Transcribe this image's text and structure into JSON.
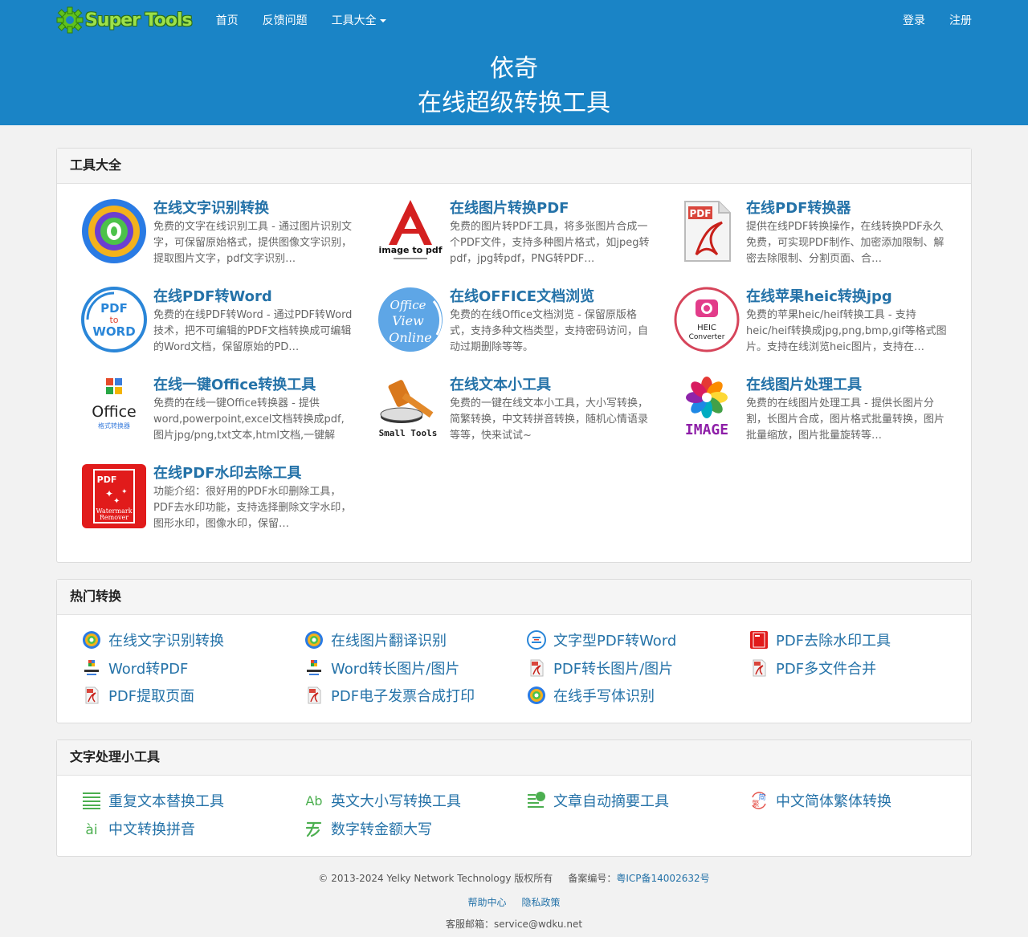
{
  "nav": {
    "logo_text": "Super Tools",
    "links": [
      "首页",
      "反馈问题",
      "工具大全"
    ],
    "login": "登录",
    "register": "注册"
  },
  "hero": {
    "title": "依奇",
    "subtitle": "在线超级转换工具"
  },
  "tools_panel": {
    "title": "工具大全",
    "items": [
      {
        "title": "在线文字识别转换",
        "desc": "免费的文字在线识别工具 - 通过图片识别文字，可保留原始格式，提供图像文字识别，提取图片文字，pdf文字识别…",
        "icon": "ocr-icon"
      },
      {
        "title": "在线图片转换PDF",
        "desc": "免费的图片转PDF工具，将多张图片合成一个PDF文件，支持多种图片格式，如jpeg转pdf，jpg转pdf，PNG转PDF…",
        "icon": "image-to-pdf-icon",
        "icon_label": "image to pdf"
      },
      {
        "title": "在线PDF转换器",
        "desc": "提供在线PDF转换操作，在线转换PDF永久免费，可实现PDF制作、加密添加限制、解密去除限制、分割页面、合…",
        "icon": "pdf-file-icon",
        "icon_label": "PDF"
      },
      {
        "title": "在线PDF转Word",
        "desc": "免费的在线PDF转Word - 通过PDF转Word技术，把不可编辑的PDF文档转换成可编辑的Word文档，保留原始的PD…",
        "icon": "pdf-to-word-icon",
        "icon_label": [
          "PDF",
          "to",
          "WORD"
        ]
      },
      {
        "title": "在线OFFICE文档浏览",
        "desc": "免费的在线Office文档浏览 - 保留原版格式，支持多种文档类型，支持密码访问，自动过期删除等等。",
        "icon": "office-view-online-icon",
        "icon_label": [
          "Office",
          "View",
          "Online"
        ]
      },
      {
        "title": "在线苹果heic转换jpg",
        "desc": "免费的苹果heic/heif转换工具 - 支持heic/heif转换成jpg,png,bmp,gif等格式图片。支持在线浏览heic图片，支持在…",
        "icon": "heic-converter-icon",
        "icon_label": [
          "HEIC",
          "Converter"
        ]
      },
      {
        "title": "在线一键Office转换工具",
        "desc": "免费的在线一键Office转换器 - 提供word,powerpoint,excel文档转换成pdf,图片jpg/png,txt文本,html文档,一键解除…",
        "icon": "office-converter-icon",
        "icon_label": [
          "Office",
          "格式转换器"
        ]
      },
      {
        "title": "在线文本小工具",
        "desc": "免费的一键在线文本小工具，大小写转换，简繁转换，中文转拼音转换，随机心情语录等等，快来试试~",
        "icon": "small-tools-hammer-icon",
        "icon_label": "Small Tools"
      },
      {
        "title": "在线图片处理工具",
        "desc": "免费的在线图片处理工具 - 提供长图片分割，长图片合成，图片格式批量转换，图片批量缩放，图片批量旋转等…",
        "icon": "image-flower-icon",
        "icon_label": "IMAGE"
      },
      {
        "title": "在线PDF水印去除工具",
        "desc": "功能介绍：很好用的PDF水印删除工具，PDF去水印功能，支持选择删除文字水印，图形水印，图像水印，保留…",
        "icon": "watermark-remover-icon",
        "icon_label": [
          "PDF",
          "Watermark",
          "Remover"
        ]
      }
    ]
  },
  "hot_panel": {
    "title": "热门转换",
    "items": [
      {
        "label": "在线文字识别转换",
        "icon": "ocr-icon"
      },
      {
        "label": "在线图片翻译识别",
        "icon": "ocr-icon"
      },
      {
        "label": "文字型PDF转Word",
        "icon": "pdf-to-word-icon"
      },
      {
        "label": "PDF去除水印工具",
        "icon": "watermark-remover-icon"
      },
      {
        "label": "Word转PDF",
        "icon": "office-icon"
      },
      {
        "label": "Word转长图片/图片",
        "icon": "office-icon"
      },
      {
        "label": "PDF转长图片/图片",
        "icon": "pdf-file-icon"
      },
      {
        "label": "PDF多文件合并",
        "icon": "pdf-file-icon"
      },
      {
        "label": "PDF提取页面",
        "icon": "pdf-file-icon"
      },
      {
        "label": "PDF电子发票合成打印",
        "icon": "pdf-file-icon"
      },
      {
        "label": "在线手写体识别",
        "icon": "ocr-icon"
      }
    ]
  },
  "text_panel": {
    "title": "文字处理小工具",
    "items": [
      {
        "label": "重复文本替换工具",
        "icon": "lines-icon"
      },
      {
        "label": "英文大小写转换工具",
        "icon": "case-icon",
        "icon_label": "Ab"
      },
      {
        "label": "文章自动摘要工具",
        "icon": "summary-icon"
      },
      {
        "label": "中文简体繁体转换",
        "icon": "simplified-traditional-icon",
        "icon_label": [
          "简",
          "繁"
        ]
      },
      {
        "label": "中文转换拼音",
        "icon": "pinyin-icon",
        "icon_label": "ài"
      },
      {
        "label": "数字转金额大写",
        "icon": "currency-icon"
      }
    ]
  },
  "footer": {
    "copyright": "© 2013-2024 Yelky Network Technology 版权所有",
    "icp_label": "备案编号：",
    "icp": "粤ICP备14002632号",
    "help": "帮助中心",
    "privacy": "隐私政策",
    "email_label": "客服邮箱：",
    "email": "service@wdku.net"
  },
  "colors": {
    "header": "#1a84c6",
    "link": "#2472a8",
    "icon_green": "#4caf50"
  }
}
